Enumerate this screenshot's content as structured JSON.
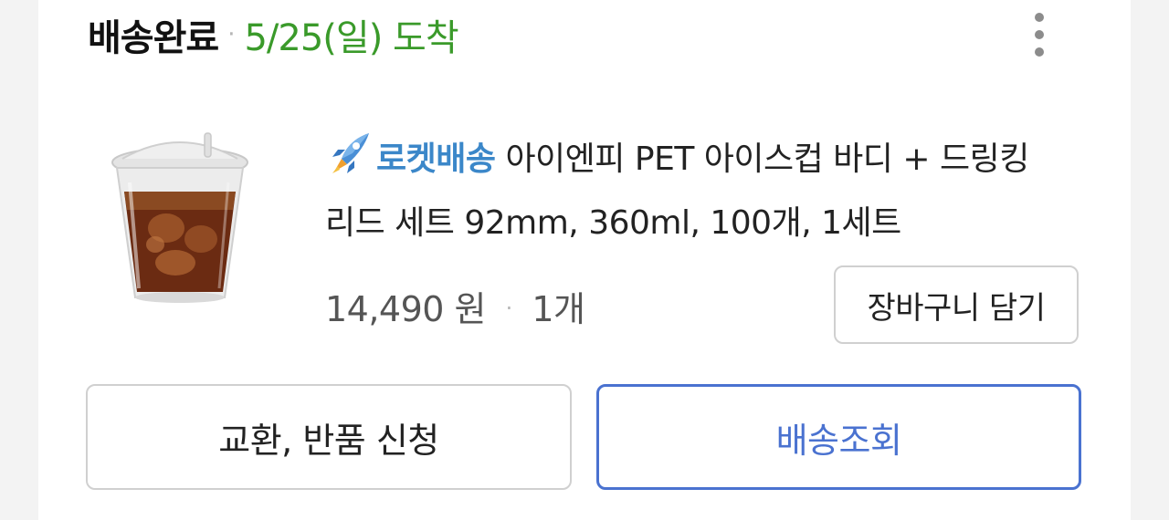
{
  "order": {
    "status_label": "배송완료",
    "separator": "·",
    "delivery_date": "5/25(일) 도착"
  },
  "product": {
    "image_alt": "PET ice cup with iced coffee",
    "badge_label": "로켓배송",
    "title": "아이엔피 PET 아이스컵 바디 + 드링킹 리드 세트 92mm, 360ml, 100개, 1세트",
    "price": "14,490 원",
    "separator": "·",
    "quantity": "1개"
  },
  "actions": {
    "cart_label": "장바구니 담기",
    "return_label": "교환, 반품 신청",
    "tracking_label": "배송조회"
  },
  "icons": {
    "more": "more-vertical-icon",
    "rocket": "rocket-icon"
  },
  "colors": {
    "status_green": "#3a9a2a",
    "rocket_blue": "#3b87c9",
    "tracking_blue": "#4a72d0"
  }
}
